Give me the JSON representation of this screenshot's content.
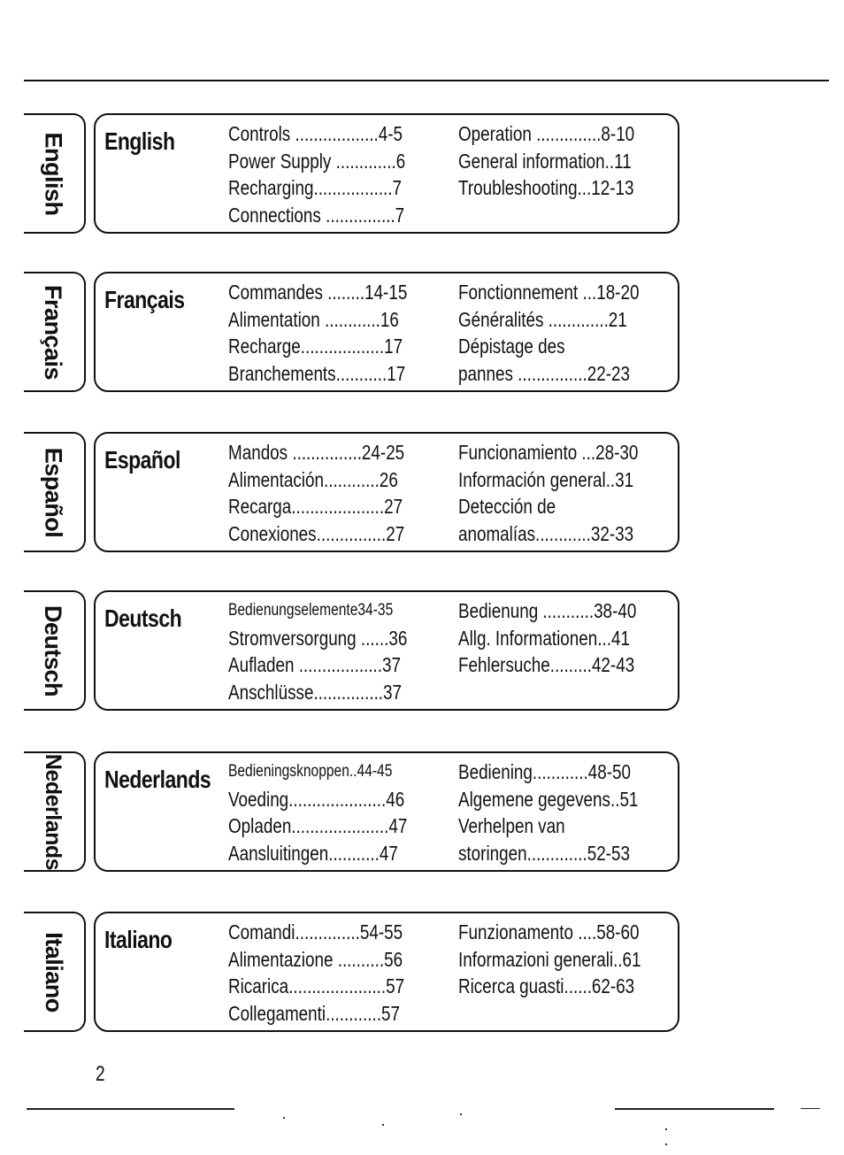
{
  "page": {
    "number": "2"
  },
  "sections": [
    {
      "tab_label": "English",
      "title": "English",
      "col1": [
        {
          "text": "Controls ..................4-5"
        },
        {
          "text": "Power Supply .............6"
        },
        {
          "text": "Recharging.................7"
        },
        {
          "text": "Connections ...............7"
        }
      ],
      "col2": [
        {
          "text": "Operation ..............8-10"
        },
        {
          "text": "General information..11"
        },
        {
          "text": "Troubleshooting...12-13"
        },
        {
          "text": ""
        }
      ]
    },
    {
      "tab_label": "Français",
      "title": "Français",
      "col1": [
        {
          "text": "Commandes ........14-15"
        },
        {
          "text": "Alimentation ............16"
        },
        {
          "text": "Recharge..................17"
        },
        {
          "text": "Branchements...........17"
        }
      ],
      "col2": [
        {
          "text": "Fonctionnement ...18-20"
        },
        {
          "text": "Généralités .............21"
        },
        {
          "text": "Dépistage des"
        },
        {
          "text": "pannes ...............22-23"
        }
      ]
    },
    {
      "tab_label": "Español",
      "title": "Español",
      "col1": [
        {
          "text": "Mandos ...............24-25"
        },
        {
          "text": "Alimentación............26"
        },
        {
          "text": "Recarga....................27"
        },
        {
          "text": "Conexiones...............27"
        }
      ],
      "col2": [
        {
          "text": "Funcionamiento ...28-30"
        },
        {
          "text": "Información general..31"
        },
        {
          "text": "Detección de"
        },
        {
          "text": "anomalías............32-33"
        }
      ]
    },
    {
      "tab_label": "Deutsch",
      "title": "Deutsch",
      "col1": [
        {
          "text": "Bedienungselemente34-35",
          "small": true
        },
        {
          "text": "Stromversorgung ......36"
        },
        {
          "text": "Aufladen ..................37"
        },
        {
          "text": "Anschlüsse...............37"
        }
      ],
      "col2": [
        {
          "text": "Bedienung ...........38-40"
        },
        {
          "text": "Allg. Informationen...41"
        },
        {
          "text": "Fehlersuche.........42-43"
        },
        {
          "text": ""
        }
      ]
    },
    {
      "tab_label": "Nederlands",
      "title": "Nederlands",
      "col1": [
        {
          "text": "Bedieningsknoppen..44-45",
          "small": true
        },
        {
          "text": "Voeding.....................46"
        },
        {
          "text": "Opladen.....................47"
        },
        {
          "text": "Aansluitingen...........47"
        }
      ],
      "col2": [
        {
          "text": "Bediening............48-50"
        },
        {
          "text": "Algemene gegevens..51"
        },
        {
          "text": "Verhelpen van"
        },
        {
          "text": "storingen.............52-53"
        }
      ]
    },
    {
      "tab_label": "Italiano",
      "title": "Italiano",
      "col1": [
        {
          "text": "Comandi..............54-55"
        },
        {
          "text": "Alimentazione ..........56"
        },
        {
          "text": "Ricarica.....................57"
        },
        {
          "text": "Collegamenti............57"
        }
      ],
      "col2": [
        {
          "text": "Funzionamento ....58-60"
        },
        {
          "text": "Informazioni generali..61"
        },
        {
          "text": "Ricerca guasti......62-63"
        },
        {
          "text": ""
        }
      ]
    }
  ]
}
